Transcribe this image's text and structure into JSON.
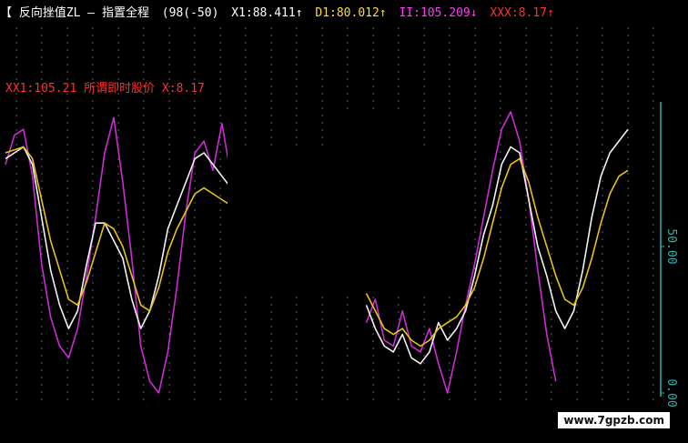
{
  "header": {
    "title": "【 反向挫值ZL — 指置全程",
    "param": "(98(-50)",
    "x1": "X1:88.411↑",
    "ii": "II:105.209↓",
    "iii": "XXX:8.17↑",
    "d1": "D1:80.012↑"
  },
  "annotation": "XX1:105.21 所谓即时股价 X:8.17",
  "watermark": "www.7gpzb.com",
  "colors": {
    "background": "#000000",
    "grid": "#606060",
    "magenta": "#cc2bd6",
    "white": "#f2f2f2",
    "yellow": "#e6c21a",
    "axis": "#2bb3b3",
    "header_white": "#ffffff",
    "header_yellow": "#ffd84a",
    "header_magenta": "#ff3cff",
    "header_red": "#ff3030"
  },
  "chart_data": {
    "type": "line",
    "x": [
      0,
      1,
      2,
      3,
      4,
      5,
      6,
      7,
      8,
      9,
      10,
      11,
      12,
      13,
      14,
      15,
      16,
      17,
      18,
      19,
      20,
      21,
      22,
      23,
      24,
      25,
      26,
      27,
      28,
      29,
      30,
      31,
      32,
      33,
      34,
      35,
      36,
      37,
      38,
      39,
      40,
      41,
      42,
      43,
      44,
      45,
      46,
      47,
      48,
      49,
      50,
      51,
      52,
      53,
      54,
      55,
      56,
      57,
      58,
      59,
      60,
      61,
      62,
      63,
      64,
      65,
      66,
      67,
      68,
      69
    ],
    "ylim": [
      0,
      100
    ],
    "yticks": [
      "50.00",
      "0.00"
    ],
    "yticks_values": [
      50,
      0
    ],
    "series": [
      {
        "color": "magenta",
        "values": [
          78,
          88,
          90,
          74,
          44,
          26,
          16,
          12,
          22,
          40,
          60,
          82,
          94,
          72,
          46,
          16,
          4,
          0,
          14,
          36,
          62,
          82,
          86,
          76,
          92,
          74,
          null,
          null,
          null,
          null,
          null,
          null,
          null,
          null,
          null,
          null,
          null,
          null,
          null,
          null,
          24,
          32,
          18,
          16,
          28,
          16,
          14,
          22,
          10,
          0,
          14,
          30,
          44,
          60,
          76,
          90,
          96,
          86,
          66,
          42,
          20,
          4,
          null,
          null,
          null,
          null,
          null,
          null,
          null,
          null
        ]
      },
      {
        "color": "white",
        "values": [
          80,
          82,
          84,
          78,
          60,
          42,
          30,
          22,
          28,
          44,
          58,
          58,
          52,
          46,
          32,
          22,
          28,
          40,
          56,
          64,
          72,
          80,
          82,
          78,
          74,
          70,
          null,
          null,
          null,
          null,
          null,
          null,
          null,
          null,
          null,
          null,
          null,
          null,
          null,
          null,
          30,
          22,
          16,
          14,
          20,
          12,
          10,
          14,
          24,
          18,
          22,
          28,
          40,
          54,
          64,
          78,
          84,
          82,
          66,
          50,
          40,
          28,
          22,
          28,
          42,
          60,
          74,
          82,
          86,
          90
        ]
      },
      {
        "color": "yellow",
        "values": [
          82,
          83,
          84,
          80,
          66,
          52,
          42,
          32,
          30,
          38,
          48,
          58,
          56,
          50,
          40,
          30,
          28,
          36,
          48,
          56,
          62,
          68,
          70,
          68,
          66,
          64,
          null,
          null,
          null,
          null,
          null,
          null,
          null,
          null,
          null,
          null,
          null,
          null,
          null,
          null,
          34,
          28,
          22,
          20,
          22,
          18,
          16,
          18,
          22,
          24,
          26,
          30,
          36,
          46,
          58,
          70,
          78,
          80,
          72,
          60,
          50,
          40,
          32,
          30,
          36,
          46,
          58,
          68,
          74,
          76
        ]
      }
    ]
  }
}
